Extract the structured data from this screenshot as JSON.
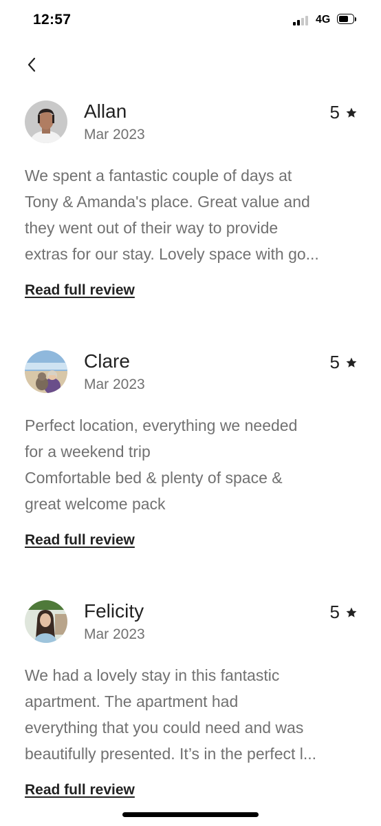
{
  "status_bar": {
    "time": "12:57",
    "network": "4G"
  },
  "nav": {
    "back_icon": "chevron-left-icon"
  },
  "reviews": [
    {
      "name": "Allan",
      "date": "Mar 2023",
      "rating": "5",
      "text": "We spent a fantastic couple of days at\nTony & Amanda's place. Great value and\nthey went out of their way to provide\nextras for our stay. Lovely space with go...",
      "link": "Read full review"
    },
    {
      "name": "Clare",
      "date": "Mar 2023",
      "rating": "5",
      "text": "Perfect location,  everything we needed\nfor a weekend trip\nComfortable bed & plenty of space &\ngreat welcome pack",
      "link": "Read full review"
    },
    {
      "name": "Felicity",
      "date": "Mar 2023",
      "rating": "5",
      "text": "We had a lovely stay in this fantastic\napartment. The apartment had\neverything that you could need and was\nbeautifully presented. It’s in the perfect l...",
      "link": "Read full review"
    }
  ],
  "colors": {
    "text": "#222222",
    "muted": "#717171",
    "background": "#ffffff"
  }
}
